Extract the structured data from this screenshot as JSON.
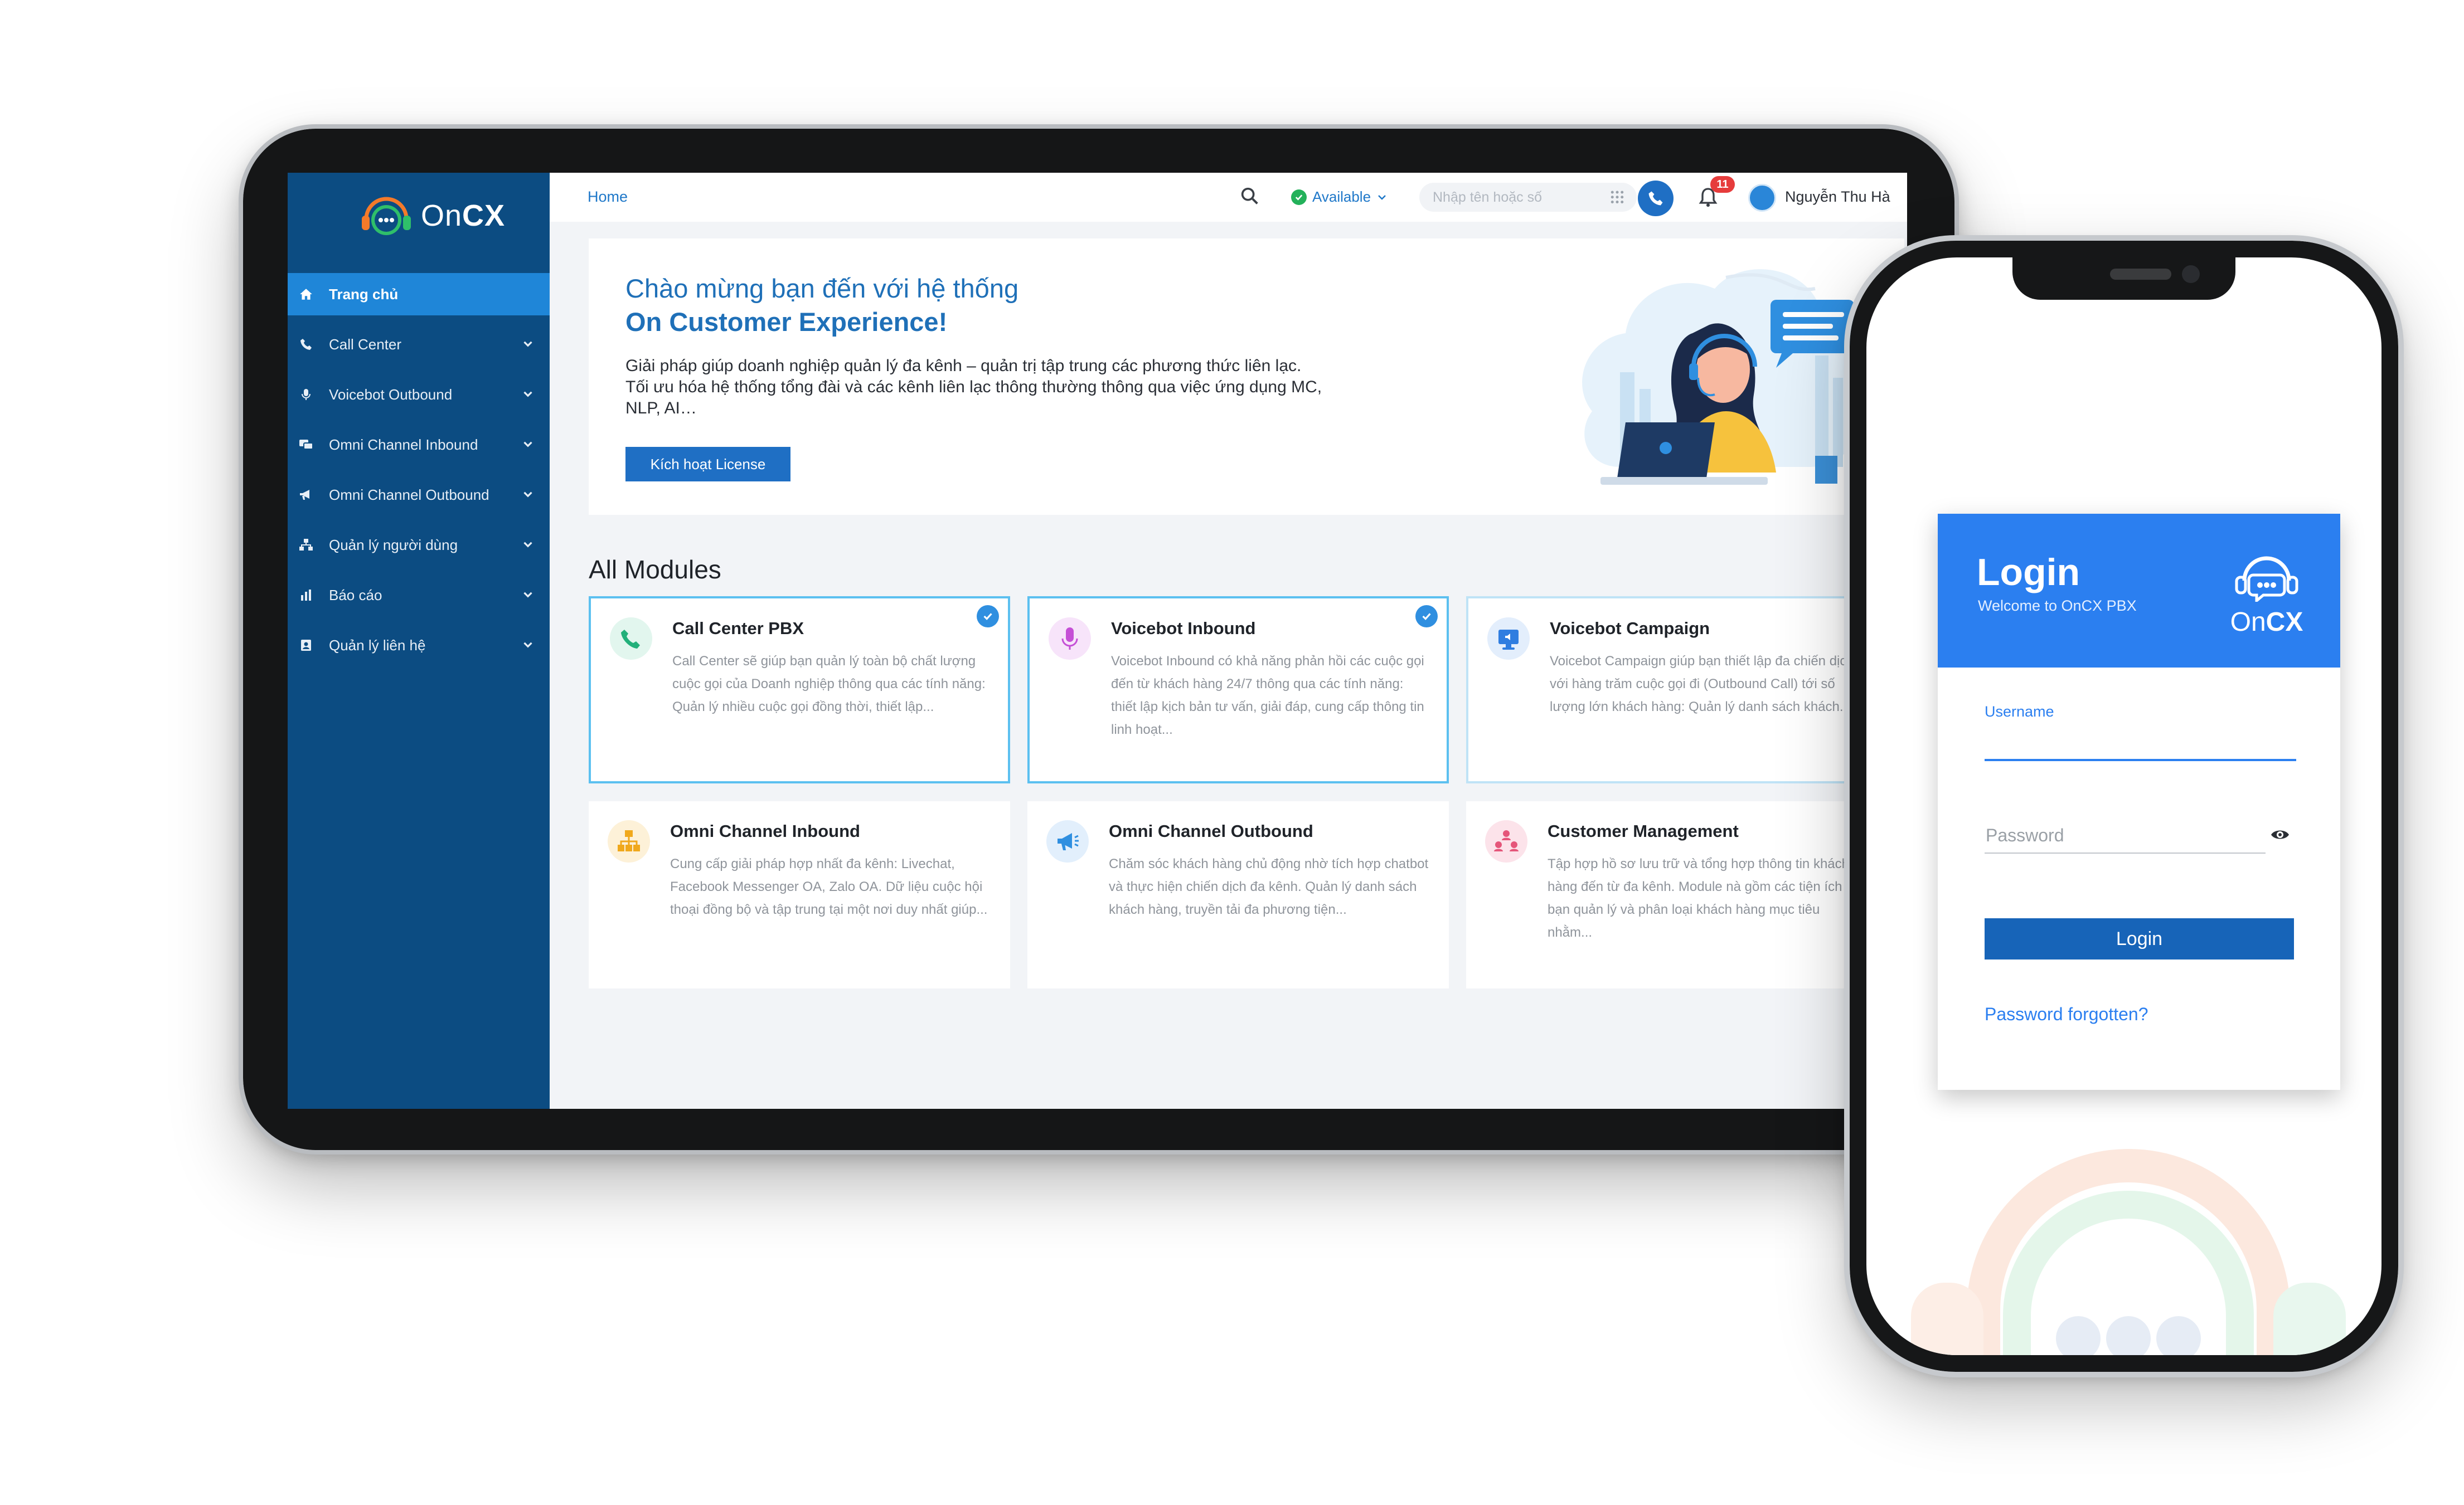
{
  "app": {
    "logo_text_a": "On",
    "logo_text_b": "CX"
  },
  "sidebar": {
    "items": [
      {
        "label": "Trang chủ",
        "icon": "home-icon",
        "active": true
      },
      {
        "label": "Call Center",
        "icon": "phone-icon"
      },
      {
        "label": "Voicebot Outbound",
        "icon": "microphone-icon"
      },
      {
        "label": "Omni Channel Inbound",
        "icon": "chat-icon"
      },
      {
        "label": "Omni Channel Outbound",
        "icon": "megaphone-icon"
      },
      {
        "label": "Quản lý người dùng",
        "icon": "org-chart-icon"
      },
      {
        "label": "Báo cáo",
        "icon": "bar-chart-icon"
      },
      {
        "label": "Quản lý liên hệ",
        "icon": "contact-card-icon"
      }
    ]
  },
  "topbar": {
    "breadcrumb": "Home",
    "status": "Available",
    "phone_placeholder": "Nhập tên hoặc số",
    "notification_count": "11",
    "user_name": "Nguyễn Thu Hà"
  },
  "hero": {
    "title_line1": "Chào mừng bạn đến với hệ thống",
    "title_line2": "On Customer Experience!",
    "description": "Giải pháp giúp doanh nghiệp quản lý đa kênh – quản trị tập trung các phương thức liên lạc. Tối ưu hóa hệ thống tổng đài và các kênh liên lạc thông thường thông qua việc ứng dụng MC, NLP, AI…",
    "button": "Kích hoạt License"
  },
  "modules": {
    "title": "All Modules",
    "cards": [
      {
        "title": "Call Center PBX",
        "desc": "Call Center sẽ giúp bạn quản lý toàn bộ chất lượng cuộc gọi của Doanh nghiệp thông qua các tính năng: Quản lý nhiều cuộc gọi đồng thời, thiết lập...",
        "selected": true,
        "icon": "phone-call-icon",
        "color": "#22b07a"
      },
      {
        "title": "Voicebot Inbound",
        "desc": "Voicebot Inbound có khả năng phản hồi các cuộc gọi đến từ khách hàng 24/7 thông qua các tính năng: thiết lập kịch bản tư vấn, giải đáp, cung cấp thông tin linh hoạt...",
        "selected": true,
        "icon": "microphone-icon",
        "color": "#c54fd6"
      },
      {
        "title": "Voicebot Campaign",
        "desc": "Voicebot Campaign giúp bạn thiết lập đa chiến dịch với hàng trăm cuộc gọi đi (Outbound Call) tới số lượng lớn khách hàng: Quản lý danh sách khách...",
        "selected": false,
        "icon": "monitor-icon",
        "color": "#2f7de0"
      },
      {
        "title": "Omni Channel Inbound",
        "desc": "Cung cấp giải pháp hợp nhất đa kênh: Livechat, Facebook Messenger OA, Zalo OA. Dữ liệu cuộc hội thoại đồng bộ và tập trung tại một nơi duy nhất giúp...",
        "selected": false,
        "icon": "network-icon",
        "color": "#f0a81c"
      },
      {
        "title": "Omni Channel Outbound",
        "desc": "Chăm sóc khách hàng chủ động nhờ tích hợp chatbot và thực hiện chiến dịch đa kênh. Quản lý danh sách khách hàng, truyền tải đa phương tiện...",
        "selected": false,
        "icon": "megaphone-icon",
        "color": "#2f8fe0"
      },
      {
        "title": "Customer Management",
        "desc": "Tập hợp hồ sơ lưu trữ và tổng hợp thông tin khách hàng đến từ đa kênh. Module nà gồm các tiện ích để bạn quản lý và phân loại khách hàng mục tiêu nhằm...",
        "selected": false,
        "icon": "people-icon",
        "color": "#e5567a"
      }
    ]
  },
  "login": {
    "title": "Login",
    "subtitle": "Welcome to OnCX PBX",
    "logo_text_a": "On",
    "logo_text_b": "CX",
    "username_label": "Username",
    "password_placeholder": "Password",
    "button": "Login",
    "forgot": "Password forgotten?"
  },
  "colors": {
    "sidebar": "#0c4c82",
    "accent": "#1f6fc4",
    "login_header": "#2b7ff0"
  }
}
